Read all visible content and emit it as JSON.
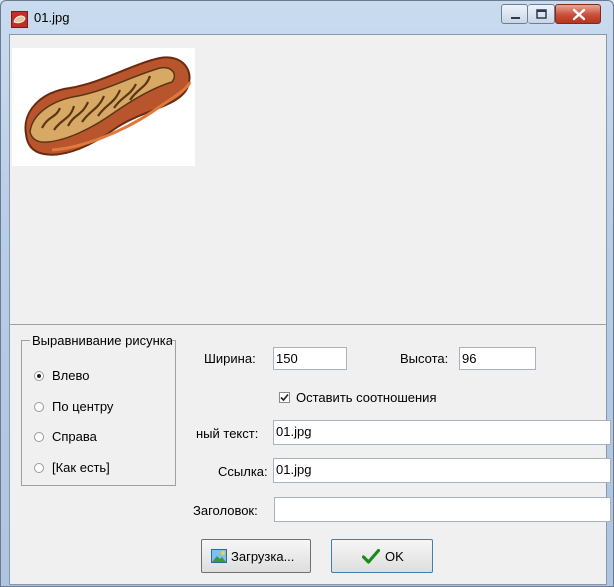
{
  "window": {
    "title": "01.jpg"
  },
  "alignment": {
    "legend": "Выравнивание рисунка",
    "options": [
      {
        "label": "Влево",
        "selected": true
      },
      {
        "label": "По центру",
        "selected": false
      },
      {
        "label": "Справа",
        "selected": false
      },
      {
        "label": "[Как есть]",
        "selected": false
      }
    ]
  },
  "size": {
    "width_label": "Ширина:",
    "width_value": "150",
    "height_label": "Высота:",
    "height_value": "96"
  },
  "keep_ratio": {
    "label": "Оставить соотношения",
    "checked": true
  },
  "alt_text": {
    "label": "ный текст:",
    "value": "01.jpg"
  },
  "link": {
    "label": "Ссылка:",
    "value": "01.jpg"
  },
  "caption": {
    "label": "Заголовок:",
    "value": ""
  },
  "buttons": {
    "load_label": "Загрузка...",
    "ok_label": "OK"
  }
}
